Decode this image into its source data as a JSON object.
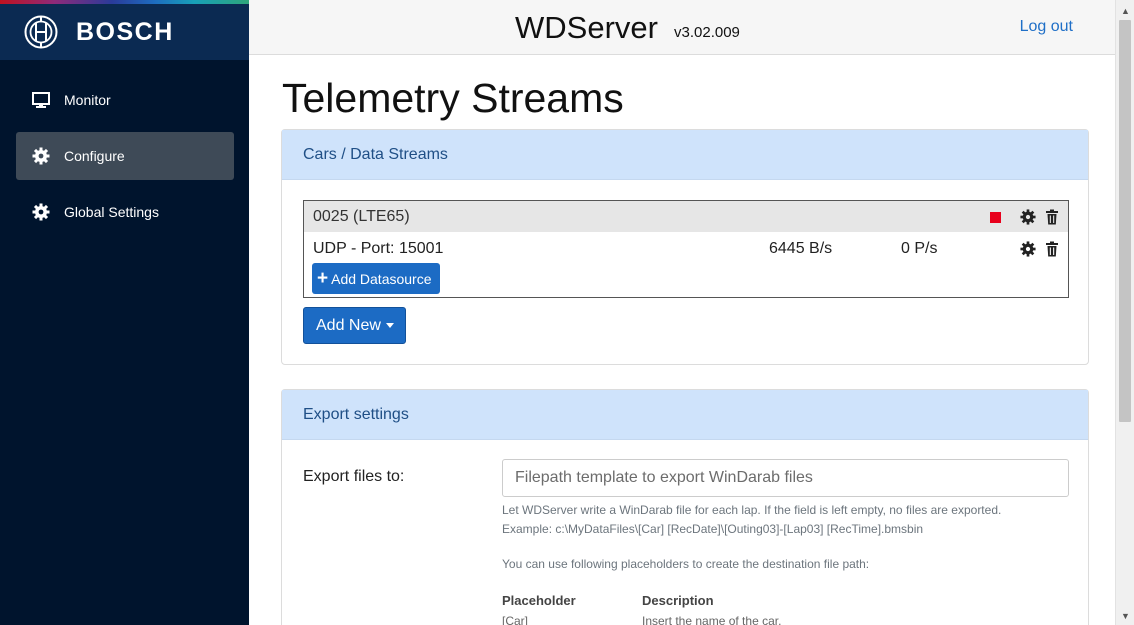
{
  "brand": {
    "name": "BOSCH",
    "logo_icon": "bosch-armature-icon"
  },
  "sidebar": {
    "items": [
      {
        "label": "Monitor",
        "icon": "monitor-icon",
        "active": false
      },
      {
        "label": "Configure",
        "icon": "gear-icon",
        "active": true
      },
      {
        "label": "Global Settings",
        "icon": "gear-icon",
        "active": false
      }
    ]
  },
  "header": {
    "title": "WDServer",
    "version": "v3.02.009",
    "logout_label": "Log out"
  },
  "main": {
    "page_title": "Telemetry Streams",
    "streams_card": {
      "title": "Cars / Data Streams",
      "car": {
        "name": "0025 (LTE65)",
        "status_icon": "stop-icon",
        "status_color": "#e8001c"
      },
      "datasource": {
        "label": "UDP - Port: 15001",
        "rate": "6445 B/s",
        "packets": "0 P/s"
      },
      "add_datasource_label": "Add Datasource",
      "add_new_label": "Add New"
    },
    "export_card": {
      "title": "Export settings",
      "field_label": "Export files to:",
      "input_placeholder": "Filepath template to export WinDarab files",
      "input_value": "",
      "help_line1": "Let WDServer write a WinDarab file for each lap. If the field is left empty, no files are exported.",
      "help_line2": "Example: c:\\MyDataFiles\\[Car] [RecDate]\\[Outing03]-[Lap03] [RecTime].bmsbin",
      "help_line3": "You can use following placeholders to create the destination file path:",
      "placeholders_table": {
        "headers": [
          "Placeholder",
          "Description"
        ],
        "rows": [
          [
            "[Car]",
            "Insert the name of the car."
          ]
        ]
      }
    }
  },
  "colors": {
    "accent": "#1c6bc4",
    "sidebar_bg": "#00142d",
    "card_header_bg": "#cfe3fb"
  }
}
